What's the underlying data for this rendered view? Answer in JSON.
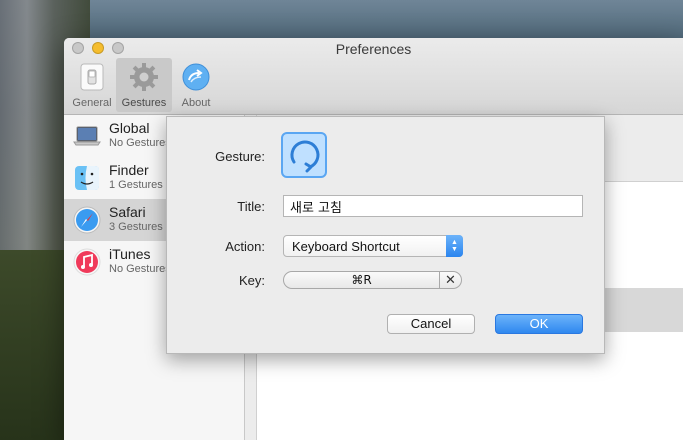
{
  "window": {
    "title": "Preferences"
  },
  "toolbar": {
    "items": [
      {
        "label": "General",
        "icon": "switch-icon"
      },
      {
        "label": "Gestures",
        "icon": "gear-icon"
      },
      {
        "label": "About",
        "icon": "arrow-circle-icon"
      }
    ],
    "selected": "Gestures"
  },
  "sidebar": {
    "items": [
      {
        "name": "Global",
        "count": "No Gestures",
        "icon": "laptop-icon"
      },
      {
        "name": "Finder",
        "count": "1 Gestures",
        "icon": "finder-icon"
      },
      {
        "name": "Safari",
        "count": "3 Gestures",
        "icon": "safari-compass-icon"
      },
      {
        "name": "iTunes",
        "count": "No Gestures",
        "icon": "itunes-music-icon"
      }
    ],
    "selected": "Safari"
  },
  "sheet": {
    "gesture_label": "Gesture:",
    "gesture_icon": "circular-arrow-gesture-icon",
    "title_label": "Title:",
    "title_value": "새로 고침",
    "action_label": "Action:",
    "action_value": "Keyboard Shortcut",
    "key_label": "Key:",
    "key_value": "⌘R",
    "clear_glyph": "✕",
    "cancel_label": "Cancel",
    "ok_label": "OK"
  },
  "colors": {
    "accent": "#2f88ef",
    "gesture_fill": "#bfe0ff"
  }
}
